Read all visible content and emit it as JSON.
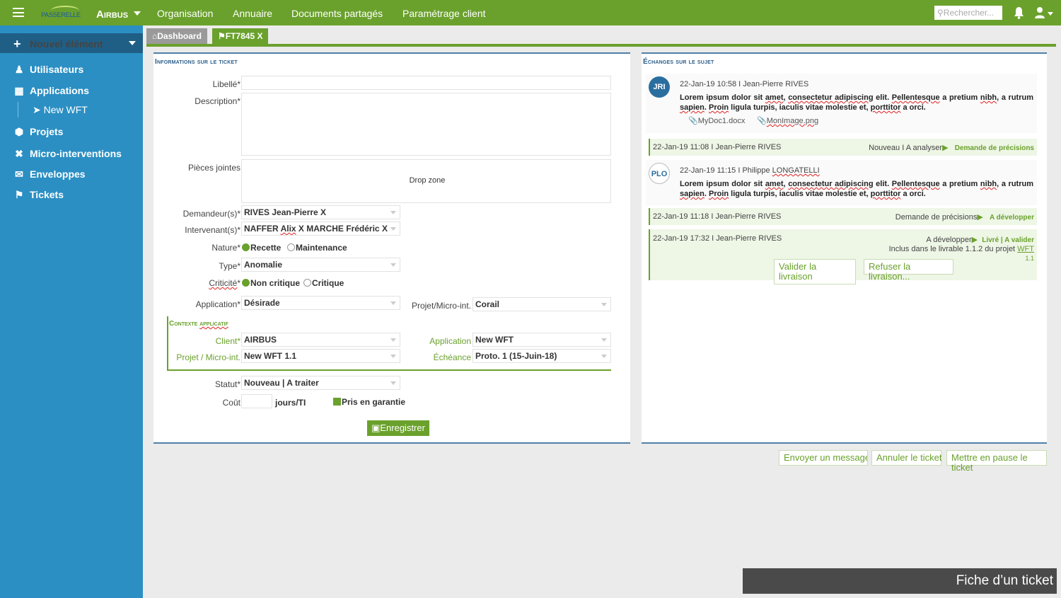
{
  "topbar": {
    "logo_text": "PASSERELLE",
    "brand": "Airbus",
    "nav": [
      "Organisation",
      "Annuaire",
      "Documents partagés",
      "Paramétrage client"
    ],
    "search_placeholder": "Rechercher...",
    "color": "#6aa12c"
  },
  "sidebar": {
    "new_element": "Nouvel élément",
    "items": [
      {
        "label": "Utilisateurs",
        "icon": "user-icon"
      },
      {
        "label": "Applications",
        "icon": "grid-icon"
      },
      {
        "label": "Projets",
        "icon": "cube-icon"
      },
      {
        "label": "Micro-interventions",
        "icon": "tools-icon"
      },
      {
        "label": "Enveloppes",
        "icon": "envelope-icon"
      },
      {
        "label": "Tickets",
        "icon": "tag-icon"
      }
    ],
    "sub_item": "New WFT",
    "color": "#2b8fc3"
  },
  "tabs": {
    "dashboard": "Dashboard",
    "ticket": "FT7845 X"
  },
  "form": {
    "title": "Informations sur le ticket",
    "libelle_label": "Libellé*",
    "libelle_value": "",
    "description_label": "Description*",
    "pieces_label": "Pièces jointes",
    "drop_zone": "Drop zone",
    "demandeur_label": "Demandeur(s)*",
    "demandeur_value": "RIVES Jean-Pierre X",
    "intervenant_label": "Intervenant(s)*",
    "intervenant_a": "NAFFER ",
    "intervenant_b": "Alix",
    "intervenant_c": " X  MARCHE Frédéric X",
    "nature_label": "Nature*",
    "nature_opt1": "Recette",
    "nature_opt2": "Maintenance",
    "type_label": "Type*",
    "type_value": "Anomalie",
    "criticite_label": "Criticité",
    "criticite_star": "*",
    "criticite_opt1": "Non critique",
    "criticite_opt2": "Critique",
    "application_label": "Application*",
    "application_value": "Désirade",
    "projet_label": "Projet/Micro-int.",
    "projet_value": "Corail",
    "contexte_title_a": "Contexte ",
    "contexte_title_b": "applicatif",
    "client_label": "Client*",
    "client_value": "AIRBUS",
    "ctx_app_label": "Application",
    "ctx_app_value": "New WFT",
    "ctx_projet_label": "Projet / Micro-int.",
    "ctx_projet_value": "New WFT 1.1",
    "echeance_label": "Échéance",
    "echeance_value": "Proto. 1 (15-Juin-18)",
    "statut_label": "Statut*",
    "statut_value": "Nouveau | A traiter",
    "cout_label": "Coût",
    "cout_value": "",
    "cout_unit": "jours/TI",
    "garantie_label": "Pris en garantie",
    "save_label": "Enregistrer"
  },
  "exchanges": {
    "title": "Échanges sur le sujet",
    "lorem_a": "Lorem ipsum dolor sit ",
    "lorem_b": "amet",
    "lorem_c": ", ",
    "lorem_d": "consectetur adipiscing",
    "lorem_e": " elit. ",
    "lorem_f": "Pellentesque",
    "lorem_g": " a pretium ",
    "lorem_h": "nibh",
    "lorem_i": ", a rutrum ",
    "lorem_j": "sapien",
    "lorem_k": ". ",
    "lorem_l": "Proin",
    "lorem_m": " ligula turpis, iaculis vitae molestie et, ",
    "lorem_n": "porttitor",
    "lorem_o": " a orci.",
    "msg1": {
      "initials": "JRI",
      "meta": "22-Jan-19  10:58  I  Jean-Pierre RIVES",
      "att1": "MyDoc1.docx",
      "att2": "MonImage.png"
    },
    "log1": {
      "meta": "22-Jan-19  11:08  I  Jean-Pierre RIVES",
      "from": "Nouveau I A analyser",
      "to": "Demande de précisions"
    },
    "msg2": {
      "initials": "PLO",
      "meta_a": "22-Jan-19  11:15  I  Philippe ",
      "meta_b": "LONGATELLI"
    },
    "log2": {
      "meta": "22-Jan-19  11:18  I  Jean-Pierre RIVES",
      "from": "Demande de précisions",
      "to": "A développer"
    },
    "log3": {
      "meta": "22-Jan-19  17:32  I  Jean-Pierre RIVES",
      "from": "A développer",
      "to": "Livré | A valider",
      "info_a": "Inclus dans le livrable 1.1.2 du projet ",
      "info_b": "WFT",
      "info_c": "1.1",
      "validate": "Valider la livraison",
      "refuse": "Refuser la livraison..."
    }
  },
  "actions": {
    "send": "Envoyer un message",
    "cancel": "Annuler le ticket",
    "pause": "Mettre en pause le ticket"
  },
  "caption": "Fiche d’un ticket"
}
